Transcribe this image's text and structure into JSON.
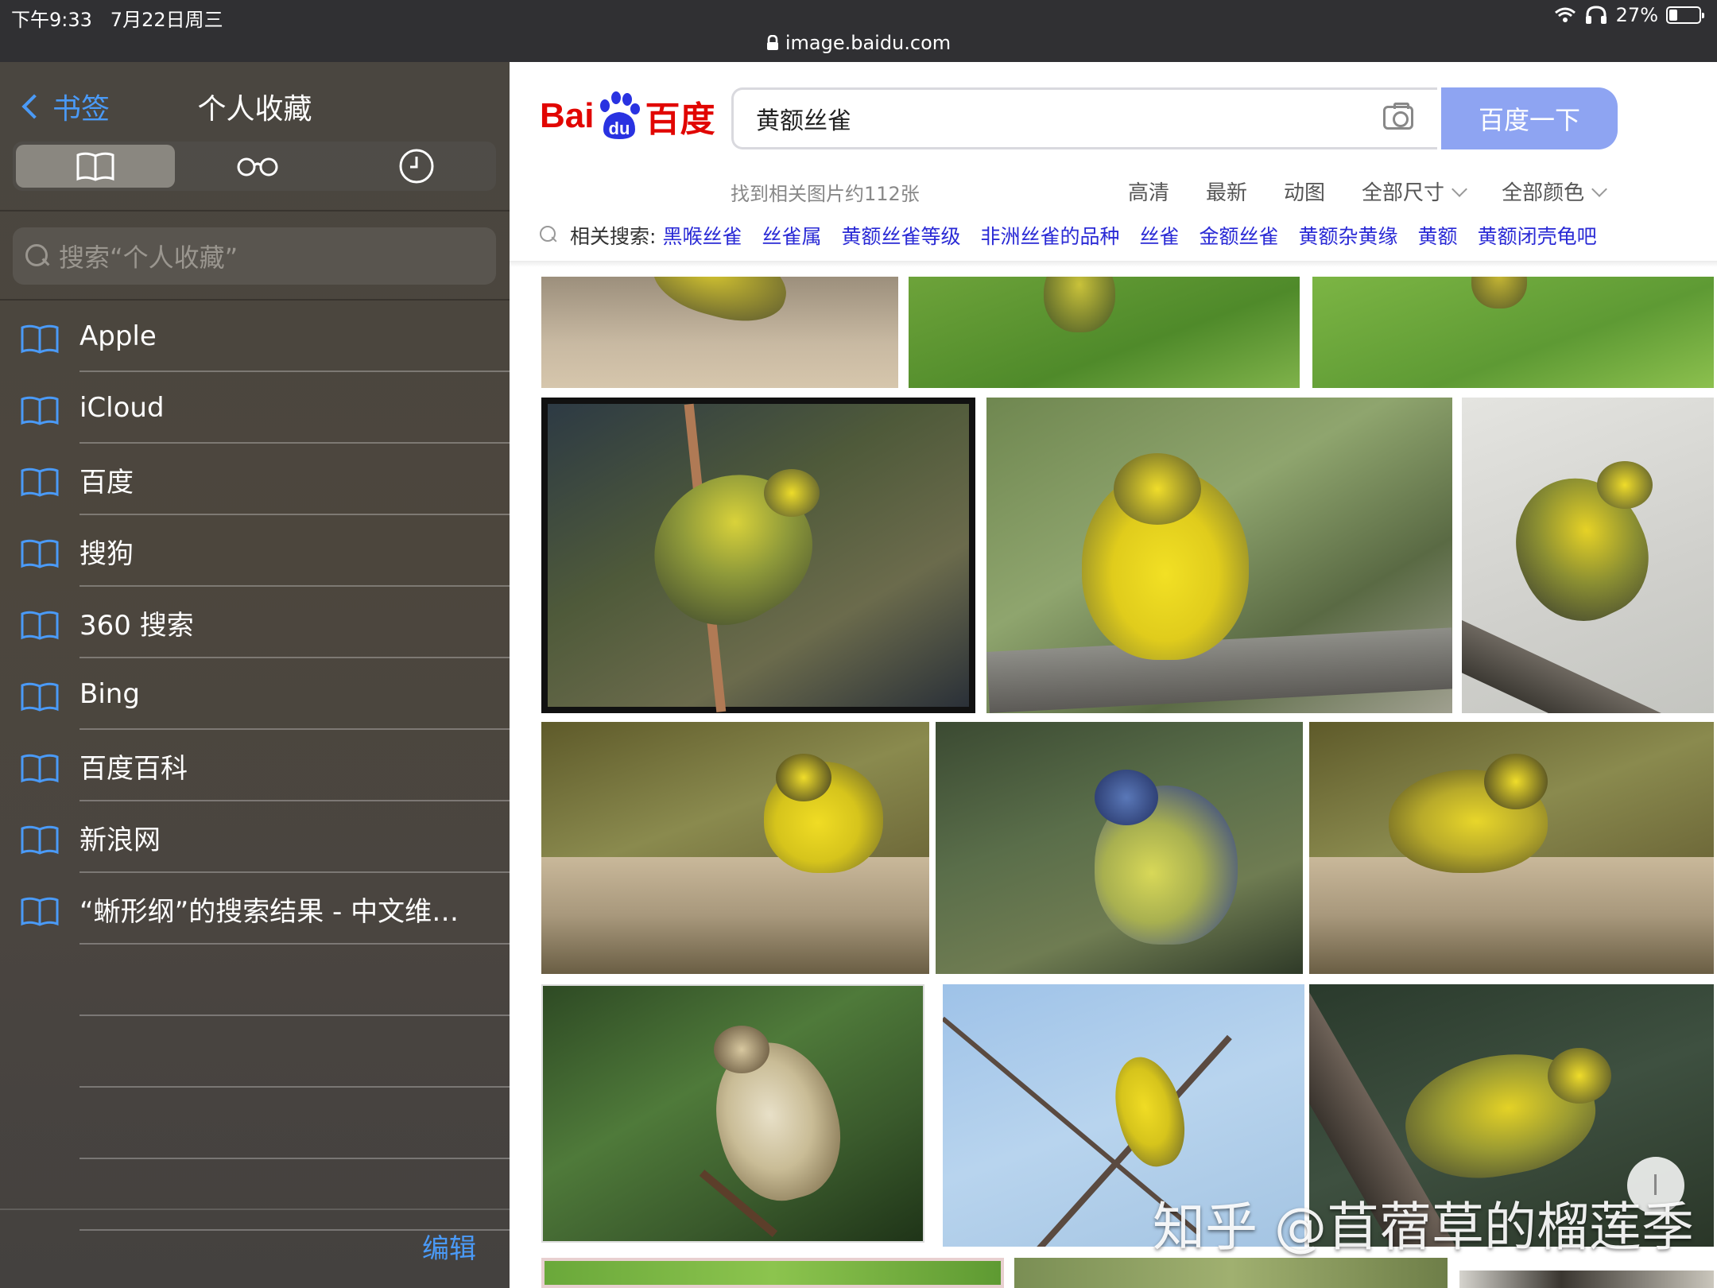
{
  "status_bar": {
    "time": "下午9:33",
    "date": "7月22日周三",
    "battery": "27%",
    "battery_level": 0.27
  },
  "url_bar": {
    "domain": "image.baidu.com",
    "lock_icon": "lock-icon"
  },
  "sidebar": {
    "back_label": "书签",
    "title": "个人收藏",
    "segments": [
      "bookmarks-icon",
      "reading-list-icon",
      "history-icon"
    ],
    "search_placeholder": "搜索“个人收藏”",
    "items": [
      {
        "label": "Apple"
      },
      {
        "label": "iCloud"
      },
      {
        "label": "百度"
      },
      {
        "label": "搜狗"
      },
      {
        "label": "360 搜索"
      },
      {
        "label": "Bing"
      },
      {
        "label": "百度百科"
      },
      {
        "label": "新浪网"
      },
      {
        "label": "“蜥形纲”的搜索结果 - 中文维…"
      }
    ],
    "edit_label": "编辑"
  },
  "baidu": {
    "logo": {
      "part1": "Bai",
      "part2": "du",
      "part3": "百度"
    },
    "query": "黄额丝雀",
    "search_button": "百度一下",
    "result_count": "找到相关图片约112张",
    "filters": [
      {
        "label": "高清",
        "dropdown": false
      },
      {
        "label": "最新",
        "dropdown": false
      },
      {
        "label": "动图",
        "dropdown": false
      },
      {
        "label": "全部尺寸",
        "dropdown": true
      },
      {
        "label": "全部颜色",
        "dropdown": true
      }
    ],
    "related_label": "相关搜索:",
    "related": [
      "黑喉丝雀",
      "丝雀属",
      "黄额丝雀等级",
      "非洲丝雀的品种",
      "丝雀",
      "金额丝雀",
      "黄额杂黄缘",
      "黄额",
      "黄额闭壳龟吧"
    ]
  },
  "watermark": "知乎 @苜蓿草的榴莲季",
  "colors": {
    "accent": "#4a9af7",
    "baidu_red": "#e10602",
    "baidu_blue": "#2932e1",
    "link": "#2a2ad5",
    "search_button": "#8ea4f2"
  }
}
